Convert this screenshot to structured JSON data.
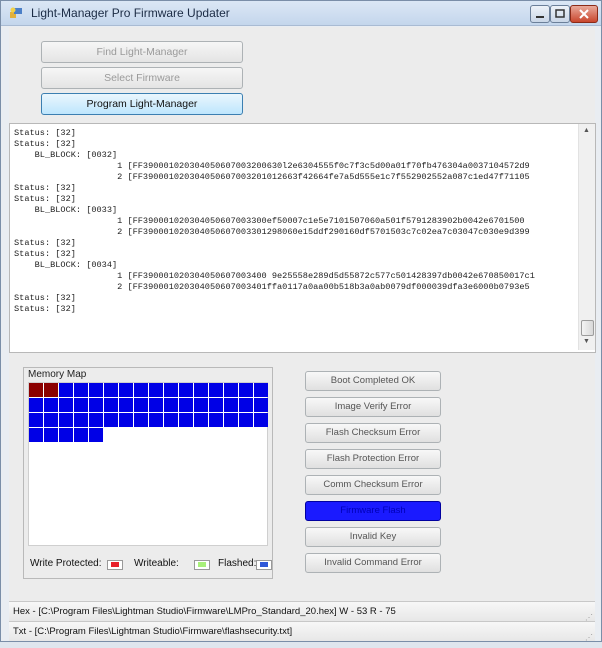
{
  "window": {
    "title": "Light-Manager Pro Firmware Updater",
    "controls": [
      "minimize",
      "maximize",
      "close"
    ],
    "icon": "app-icon"
  },
  "buttons": {
    "find": "Find Light-Manager",
    "select": "Select Firmware",
    "program": "Program Light-Manager"
  },
  "log": {
    "lines": [
      "Status: [32]",
      "Status: [32]",
      "    BL_BLOCK: [0032]",
      "                    1 [FF390001020304050607003200630l2e6304555f0c7f3c5d00a01f70fb476304a0037104572d9",
      "                    2 [FF390001020304050607003201012663f42664fe7a5d555e1c7f552902552a087c1ed47f71105",
      "Status: [32]",
      "Status: [32]",
      "    BL_BLOCK: [0033]",
      "                    1 [FF390001020304050607003300ef50007c1e5e7101507060a501f5791283902b0042e6701500",
      "                    2 [FF390001020304050607003301298060e15ddf290160df5701503c7c02ea7c03047c030e9d399",
      "Status: [32]",
      "Status: [32]",
      "    BL_BLOCK: [0034]",
      "                    1 [FF390001020304050607003400 9e25558e289d5d55872c577c501428397db0042e670850017c1",
      "                    2 [FF390001020304050607003401ffa0117a0aa00b518b3a0ab0079df000039dfa3e6000b0793e5",
      "Status: [32]",
      "Status: [32]"
    ]
  },
  "memory_map": {
    "label": "Memory Map",
    "rows": [
      [
        "write-protected",
        "write-protected",
        "flashed",
        "flashed",
        "flashed",
        "flashed",
        "flashed",
        "flashed",
        "flashed",
        "flashed",
        "flashed",
        "flashed",
        "flashed",
        "flashed",
        "flashed",
        "flashed"
      ],
      [
        "flashed",
        "flashed",
        "flashed",
        "flashed",
        "flashed",
        "flashed",
        "flashed",
        "flashed",
        "flashed",
        "flashed",
        "flashed",
        "flashed",
        "flashed",
        "flashed",
        "flashed",
        "flashed"
      ],
      [
        "flashed",
        "flashed",
        "flashed",
        "flashed",
        "flashed",
        "flashed",
        "flashed",
        "flashed",
        "flashed",
        "flashed",
        "flashed",
        "flashed",
        "flashed",
        "flashed",
        "flashed",
        "flashed"
      ],
      [
        "flashed",
        "flashed",
        "flashed",
        "flashed",
        "flashed"
      ]
    ],
    "legend": {
      "write_protected": "Write Protected:",
      "writeable": "Writeable:",
      "flashed": "Flashed:"
    },
    "colors": {
      "write_protected": "#8b0000",
      "writeable": "#a8f07a",
      "flashed": "#0000e6",
      "legend_write_protected": "#e8202a",
      "legend_flashed": "#2f58d8"
    }
  },
  "status_buttons": [
    {
      "label": "Boot Completed OK",
      "active": false
    },
    {
      "label": "Image Verify Error",
      "active": false
    },
    {
      "label": "Flash Checksum Error",
      "active": false
    },
    {
      "label": "Flash Protection Error",
      "active": false
    },
    {
      "label": "Comm Checksum Error",
      "active": false
    },
    {
      "label": "Firmware Flash",
      "active": true
    },
    {
      "label": "Invalid Key",
      "active": false
    },
    {
      "label": "Invalid Command Error",
      "active": false
    }
  ],
  "statusbar": {
    "hex": "Hex - [C:\\Program Files\\Lightman Studio\\Firmware\\LMPro_Standard_20.hex]  W - 53  R - 75",
    "txt": "Txt - [C:\\Program Files\\Lightman Studio\\Firmware\\flashsecurity.txt]"
  }
}
